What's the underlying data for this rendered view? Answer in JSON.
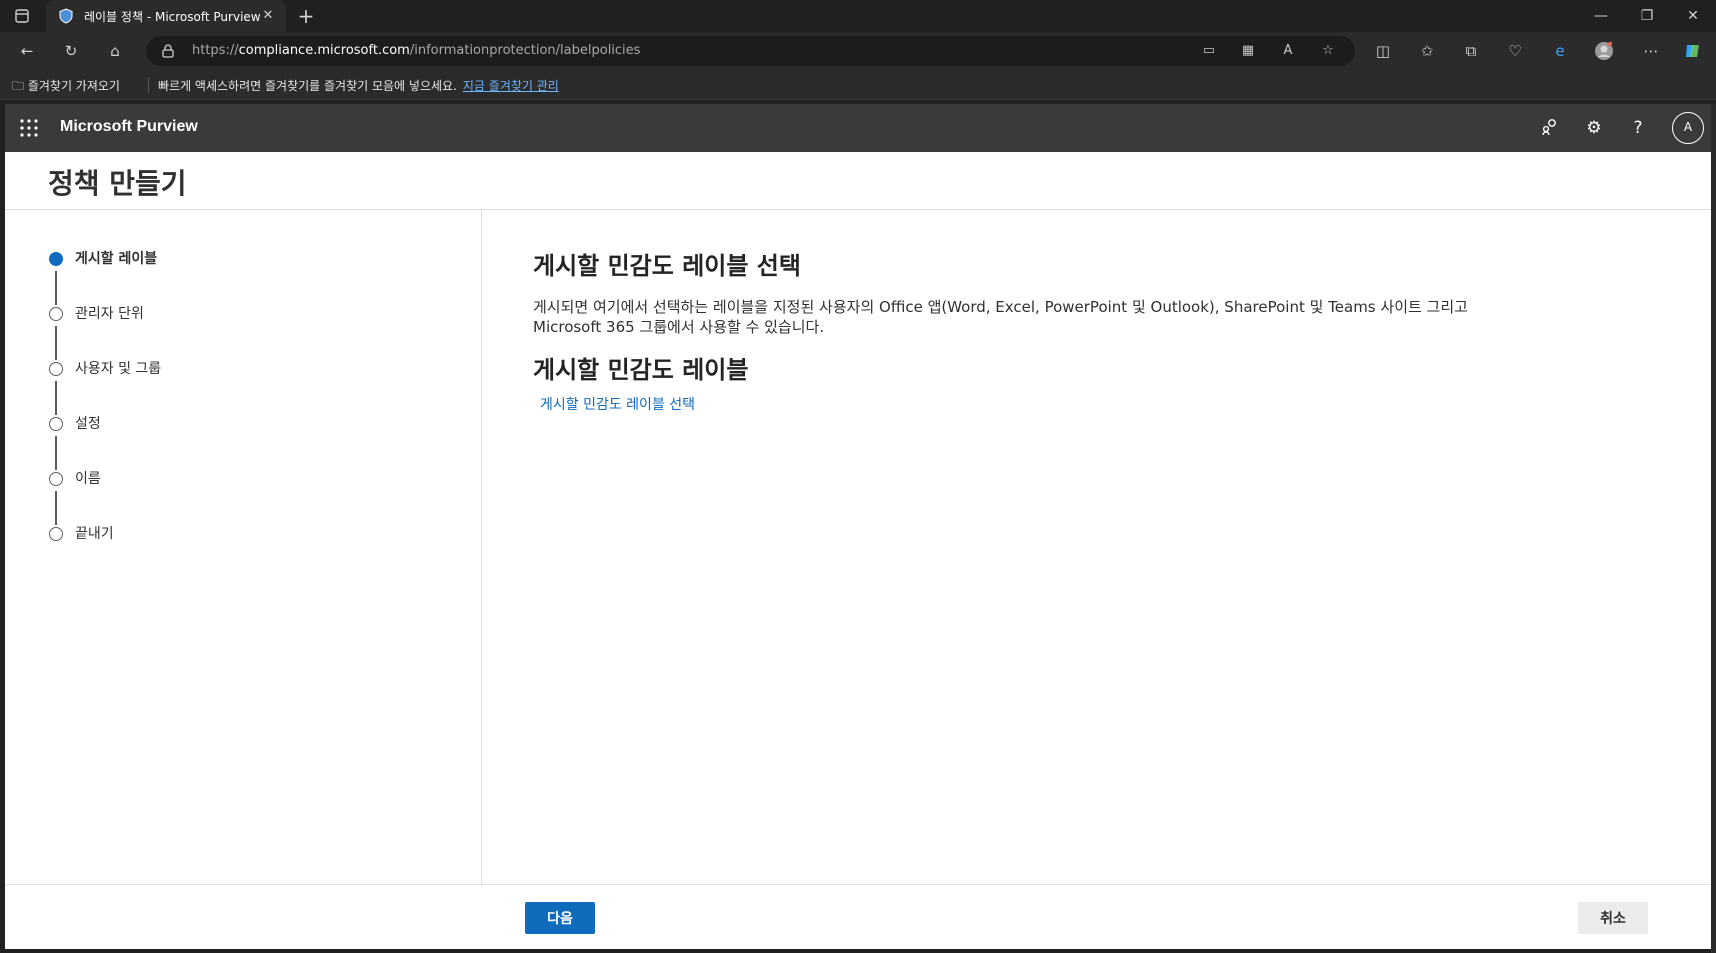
{
  "browser": {
    "tab_title": "레이블 정책 - Microsoft Purview",
    "url_prefix": "https://",
    "url_host": "compliance.microsoft.com",
    "url_path": "/informationprotection/labelpolicies",
    "favorites_import": "즐겨찾기 가져오기",
    "favorites_hint": "빠르게 액세스하려면 즐겨찾기를 즐겨찾기 모음에 넣으세요.",
    "favorites_manage": "지금 즐겨찾기 관리"
  },
  "app": {
    "brand": "Microsoft Purview",
    "avatar_initial": "A"
  },
  "page": {
    "title": "정책 만들기"
  },
  "steps": [
    {
      "label": "게시할 레이블",
      "active": true
    },
    {
      "label": "관리자 단위",
      "active": false
    },
    {
      "label": "사용자 및 그룹",
      "active": false
    },
    {
      "label": "설정",
      "active": false
    },
    {
      "label": "이름",
      "active": false
    },
    {
      "label": "끝내기",
      "active": false
    }
  ],
  "content": {
    "heading": "게시할 민감도 레이블 선택",
    "description": "게시되면 여기에서 선택하는 레이블을 지정된 사용자의 Office 앱(Word, Excel, PowerPoint 및 Outlook), SharePoint 및 Teams 사이트 그리고 Microsoft 365 그룹에서 사용할 수 있습니다.",
    "subheading": "게시할 민감도 레이블",
    "select_link": "게시할 민감도 레이블 선택"
  },
  "footer": {
    "next_label": "다음",
    "cancel_label": "취소"
  },
  "colors": {
    "accent": "#0f6cbd",
    "suitebar": "#3b3a39"
  }
}
